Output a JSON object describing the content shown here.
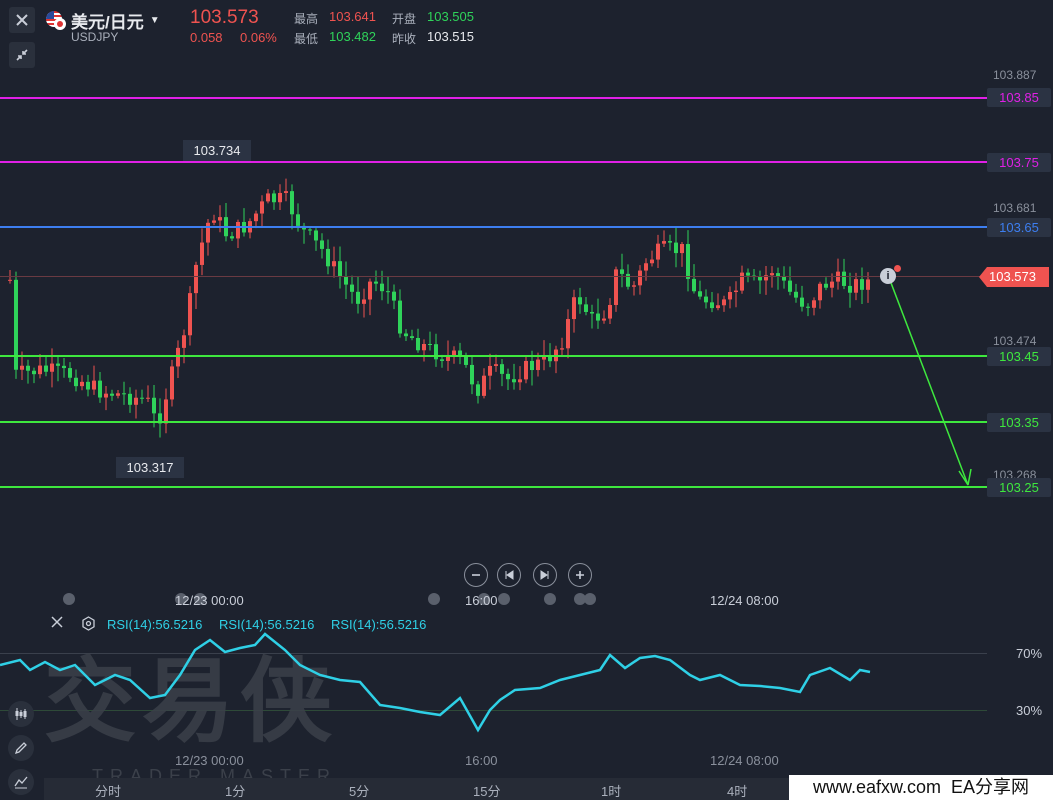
{
  "header": {
    "symbol_cn": "美元/日元",
    "symbol_code": "USDJPY",
    "price": "103.573",
    "change": "0.058",
    "change_pct": "0.06%",
    "high_label": "最高",
    "high": "103.641",
    "low_label": "最低",
    "low": "103.482",
    "open_label": "开盘",
    "open": "103.505",
    "prev_label": "昨收",
    "prev": "103.515"
  },
  "price_axis": {
    "ticks": [
      "103.887",
      "103.681",
      "103.474",
      "103.268"
    ]
  },
  "levels": [
    {
      "label": "103.85",
      "color": "#e020e6"
    },
    {
      "label": "103.75",
      "color": "#e020e6"
    },
    {
      "label": "103.65",
      "color": "#3d7ef0"
    },
    {
      "label": "103.45",
      "color": "#3ee83e"
    },
    {
      "label": "103.35",
      "color": "#3ee83e"
    },
    {
      "label": "103.25",
      "color": "#3ee83e"
    }
  ],
  "current_price_tag": "103.573",
  "annotations": {
    "high_marker": "103.734",
    "low_marker": "103.317"
  },
  "time_axis": {
    "labels": [
      "12/23 00:00",
      "16:00",
      "12/24 08:00"
    ]
  },
  "rsi": {
    "labels": [
      "RSI(14):56.5216",
      "RSI(14):56.5216",
      "RSI(14):56.5216"
    ],
    "levels": [
      "70%",
      "30%"
    ],
    "time_labels": [
      "12/23 00:00",
      "16:00",
      "12/24 08:00"
    ]
  },
  "timeframes": [
    "分时",
    "1分",
    "5分",
    "15分",
    "1时",
    "4时"
  ],
  "watermark": {
    "cn": "交易侠",
    "en": "TRADER MASTER"
  },
  "footer_text": "www.eafxw.com  EA分享网",
  "colors": {
    "bg": "#1d222e",
    "up": "#ef5350",
    "down": "#2fd35a",
    "rsi": "#2fd0e6"
  }
}
